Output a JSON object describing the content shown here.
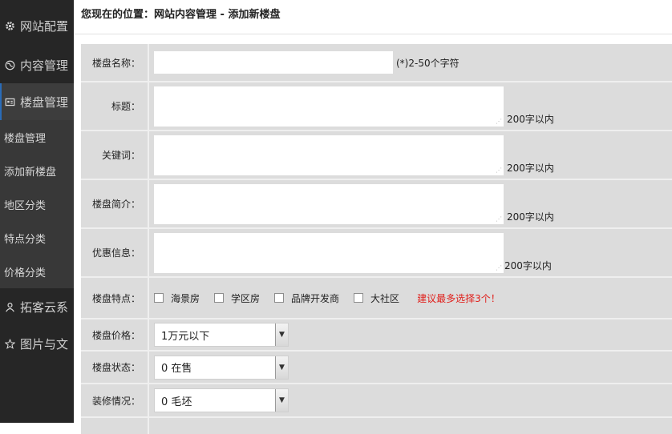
{
  "sidebar": {
    "menus": [
      {
        "label": "网站配置",
        "icon": "gear-icon"
      },
      {
        "label": "内容管理",
        "icon": "globe-icon"
      },
      {
        "label": "楼盘管理",
        "icon": "building-icon"
      }
    ],
    "submenu": [
      "楼盘管理",
      "添加新楼盘",
      "地区分类",
      "特点分类",
      "价格分类"
    ],
    "menus_after": [
      {
        "label": "拓客云系",
        "icon": "user-icon"
      },
      {
        "label": "图片与文",
        "icon": "star-icon"
      }
    ]
  },
  "breadcrumb": "您现在的位置：网站内容管理 - 添加新楼盘",
  "form": {
    "name": {
      "label": "楼盘名称：",
      "value": "",
      "hint": "(*)2-50个字符"
    },
    "title": {
      "label": "标题：",
      "value": "",
      "hint": "200字以内"
    },
    "keywords": {
      "label": "关键词：",
      "value": "",
      "hint": "200字以内"
    },
    "intro": {
      "label": "楼盘简介：",
      "value": "",
      "hint": "200字以内"
    },
    "promo": {
      "label": "优惠信息：",
      "value": "",
      "hint": "200字以内"
    },
    "features": {
      "label": "楼盘特点：",
      "options": [
        "海景房",
        "学区房",
        "品牌开发商",
        "大社区"
      ],
      "warning": "建议最多选择3个！"
    },
    "price": {
      "label": "楼盘价格：",
      "selected": "1万元以下"
    },
    "status": {
      "label": "楼盘状态：",
      "selected": "0 在售"
    },
    "decoration": {
      "label": "装修情况：",
      "selected": "0 毛坯"
    }
  },
  "colors": {
    "sidebar_bg": "#262626",
    "form_bg": "#dcdcdc",
    "warning": "#e0201c",
    "active_accent": "#2a6cb8"
  }
}
